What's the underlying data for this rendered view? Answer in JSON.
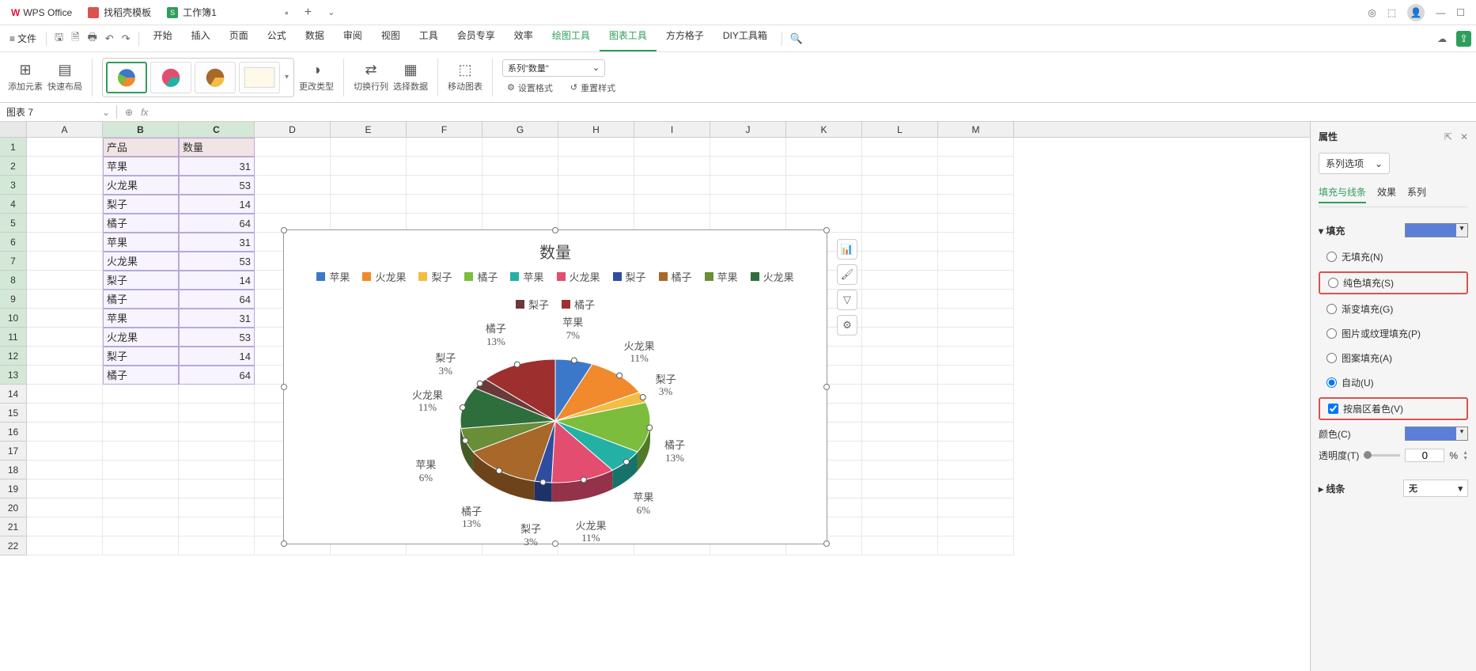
{
  "app_name": "WPS Office",
  "tabs": [
    {
      "icon": "red",
      "label": "找稻壳模板"
    },
    {
      "icon": "green",
      "letter": "S",
      "label": "工作簿1",
      "active": true
    }
  ],
  "menu": {
    "file": "文件",
    "items": [
      "开始",
      "插入",
      "页面",
      "公式",
      "数据",
      "审阅",
      "视图",
      "工具",
      "会员专享",
      "效率",
      "绘图工具",
      "图表工具",
      "方方格子",
      "DIY工具箱"
    ],
    "drawing_tools_idx": 10,
    "chart_tools_idx": 11
  },
  "toolbar": {
    "add_element": "添加元素",
    "quick_layout": "快速布局",
    "change_type": "更改类型",
    "switch_rc": "切换行列",
    "select_data": "选择数据",
    "move_chart": "移动图表",
    "series_drop": "系列\"数量\"",
    "set_format": "设置格式",
    "reset_style": "重置样式"
  },
  "name_box": "图表 7",
  "columns": [
    "A",
    "B",
    "C",
    "D",
    "E",
    "F",
    "G",
    "H",
    "I",
    "J",
    "K",
    "L",
    "M"
  ],
  "table": {
    "header": {
      "b": "产品",
      "c": "数量"
    },
    "rows": [
      {
        "b": "苹果",
        "c": 31
      },
      {
        "b": "火龙果",
        "c": 53
      },
      {
        "b": "梨子",
        "c": 14
      },
      {
        "b": "橘子",
        "c": 64
      },
      {
        "b": "苹果",
        "c": 31
      },
      {
        "b": "火龙果",
        "c": 53
      },
      {
        "b": "梨子",
        "c": 14
      },
      {
        "b": "橘子",
        "c": 64
      },
      {
        "b": "苹果",
        "c": 31
      },
      {
        "b": "火龙果",
        "c": 53
      },
      {
        "b": "梨子",
        "c": 14
      },
      {
        "b": "橘子",
        "c": 64
      }
    ]
  },
  "chart_data": {
    "type": "pie",
    "title": "数量",
    "series": [
      {
        "name": "苹果",
        "value": 31,
        "pct": "7%",
        "color": "#3b78c9"
      },
      {
        "name": "火龙果",
        "value": 53,
        "pct": "11%",
        "color": "#f08a2d"
      },
      {
        "name": "梨子",
        "value": 14,
        "pct": "3%",
        "color": "#f2bd42"
      },
      {
        "name": "橘子",
        "value": 64,
        "pct": "13%",
        "color": "#7cbd3d"
      },
      {
        "name": "苹果",
        "value": 31,
        "pct": "6%",
        "color": "#23b1a5"
      },
      {
        "name": "火龙果",
        "value": 53,
        "pct": "11%",
        "color": "#e34d6f"
      },
      {
        "name": "梨子",
        "value": 14,
        "pct": "3%",
        "color": "#2e4da0"
      },
      {
        "name": "橘子",
        "value": 64,
        "pct": "13%",
        "color": "#a8682a"
      },
      {
        "name": "苹果",
        "value": 31,
        "pct": "6%",
        "color": "#6a8d38"
      },
      {
        "name": "火龙果",
        "value": 53,
        "pct": "11%",
        "color": "#2e6e3d"
      },
      {
        "name": "梨子",
        "value": 14,
        "pct": "3%",
        "color": "#6a3a3a"
      },
      {
        "name": "橘子",
        "value": 64,
        "pct": "13%",
        "color": "#9e2f2f"
      }
    ]
  },
  "props": {
    "title": "属性",
    "series_options": "系列选项",
    "tabs": [
      "填充与线条",
      "效果",
      "系列"
    ],
    "active_tab": 0,
    "fill_section": "填充",
    "options": {
      "no_fill": "无填充(N)",
      "solid_fill": "纯色填充(S)",
      "gradient_fill": "渐变填充(G)",
      "pic_texture": "图片或纹理填充(P)",
      "pattern_fill": "图案填充(A)",
      "auto": "自动(U)",
      "vary_by_slice": "按扇区着色(V)"
    },
    "color_label": "颜色(C)",
    "transparency_label": "透明度(T)",
    "transparency_value": "0",
    "pct": "%",
    "line_section": "线条",
    "line_value": "无"
  }
}
